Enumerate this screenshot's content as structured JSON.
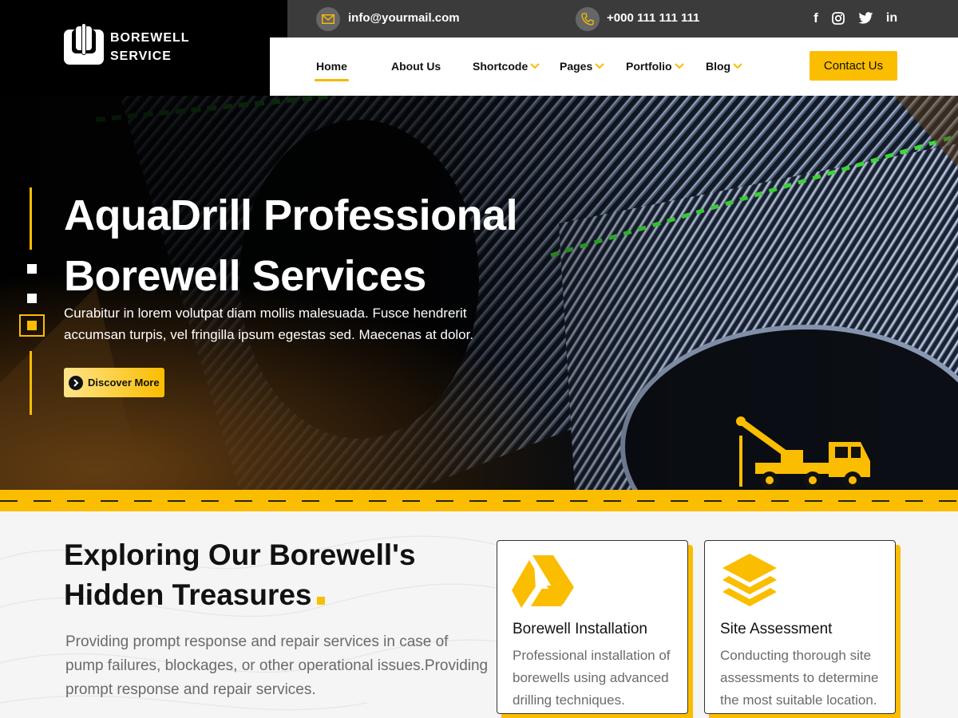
{
  "brand": {
    "line1": "BOREWELL",
    "line2": "SERVICE"
  },
  "topbar": {
    "email": "info@yourmail.com",
    "phone": "+000 111 111 111",
    "social": [
      {
        "name": "facebook-icon",
        "glyph": "f"
      },
      {
        "name": "instagram-icon",
        "glyph": ""
      },
      {
        "name": "twitter-icon",
        "glyph": ""
      },
      {
        "name": "linkedin-icon",
        "glyph": "in"
      }
    ]
  },
  "nav": {
    "items": [
      {
        "label": "Home",
        "active": true,
        "dropdown": false
      },
      {
        "label": "About Us",
        "active": false,
        "dropdown": false
      },
      {
        "label": "Shortcode",
        "active": false,
        "dropdown": true
      },
      {
        "label": "Pages",
        "active": false,
        "dropdown": true
      },
      {
        "label": "Portfolio",
        "active": false,
        "dropdown": true
      },
      {
        "label": "Blog",
        "active": false,
        "dropdown": true
      }
    ],
    "cta": "Contact Us"
  },
  "hero": {
    "title_line1": "AquaDrill Professional",
    "title_line2": "Borewell Services",
    "description": "Curabitur in lorem volutpat diam mollis malesuada. Fusce hendrerit accumsan turpis, vel fringilla ipsum egestas sed. Maecenas at dolor.",
    "button": "Discover More",
    "slides_total": 3,
    "slide_active": 3
  },
  "section": {
    "title_line1": "Exploring Our Borewell's",
    "title_line2": "Hidden Treasures",
    "text": "Providing prompt response and repair services in case of pump failures, blockages, or other operational issues.Providing prompt response and repair services."
  },
  "cards": [
    {
      "icon": "drive-triangle-icon",
      "title": "Borewell Installation",
      "text": "Professional installation of borewells using advanced drilling techniques."
    },
    {
      "icon": "layers-icon",
      "title": "Site Assessment",
      "text": "Conducting thorough site assessments to determine the most suitable location."
    }
  ],
  "colors": {
    "accent": "#fbbd00",
    "dark": "#000000",
    "topbar": "#3b3b3b"
  }
}
